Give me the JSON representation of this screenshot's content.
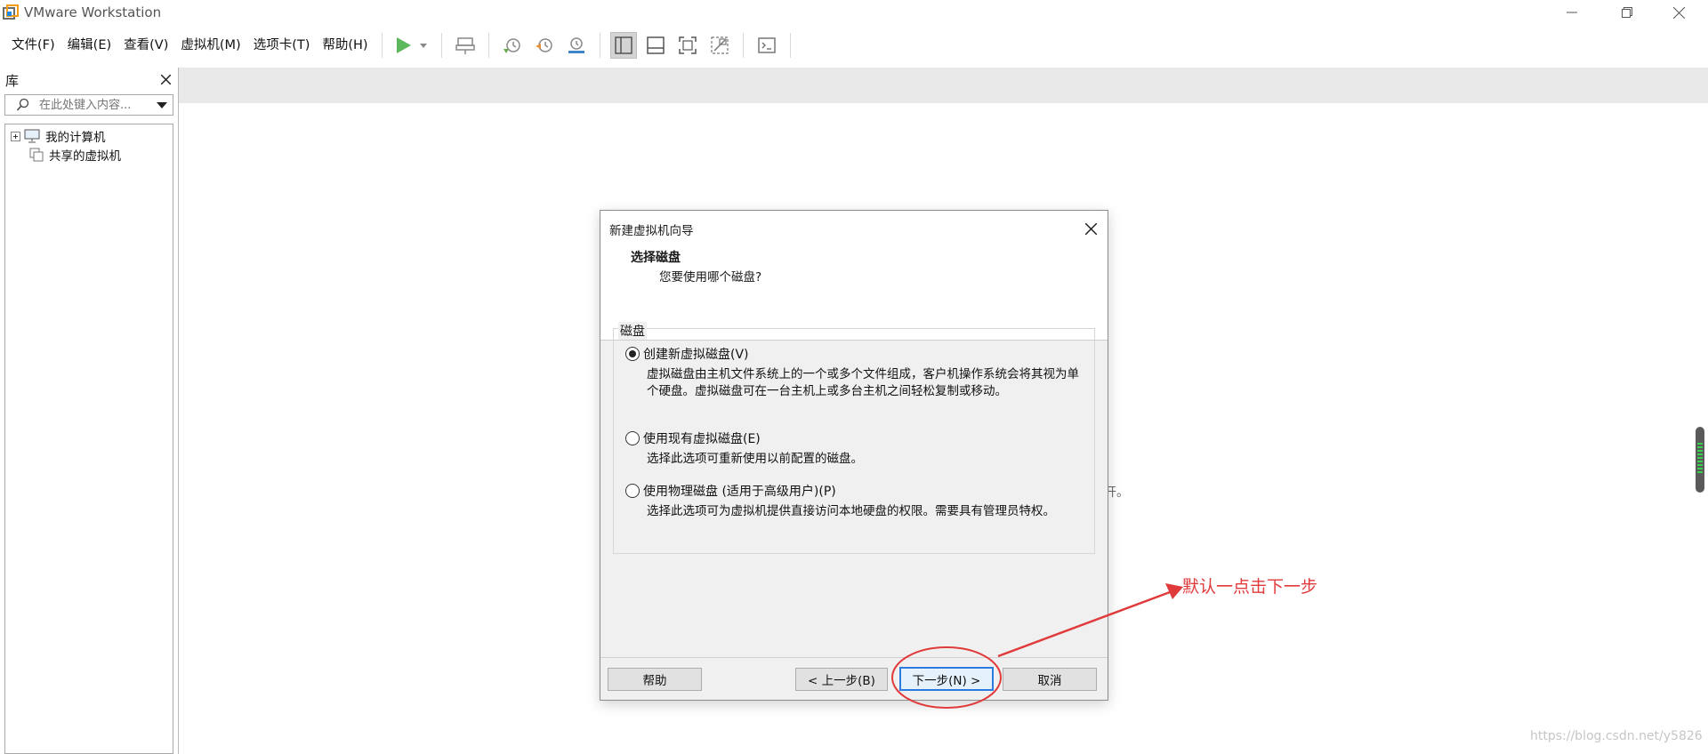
{
  "window": {
    "title": "VMware Workstation"
  },
  "menu": {
    "items": [
      {
        "label": "文件(F)"
      },
      {
        "label": "编辑(E)"
      },
      {
        "label": "查看(V)"
      },
      {
        "label": "虚拟机(M)"
      },
      {
        "label": "选项卡(T)"
      },
      {
        "label": "帮助(H)"
      }
    ]
  },
  "library": {
    "title": "库",
    "search_placeholder": "在此处键入内容...",
    "tree": [
      {
        "label": "我的计算机"
      },
      {
        "label": "共享的虚拟机"
      }
    ]
  },
  "main": {
    "background_text_fragment": "开。",
    "watermark": "https://blog.csdn.net/y5826"
  },
  "dialog": {
    "title": "新建虚拟机向导",
    "heading": "选择磁盘",
    "subheading": "您要使用哪个磁盘?",
    "group_label": "磁盘",
    "options": [
      {
        "label": "创建新虚拟磁盘(V)",
        "checked": true,
        "description": "虚拟磁盘由主机文件系统上的一个或多个文件组成，客户机操作系统会将其视为单个硬盘。虚拟磁盘可在一台主机上或多台主机之间轻松复制或移动。"
      },
      {
        "label": "使用现有虚拟磁盘(E)",
        "checked": false,
        "description": "选择此选项可重新使用以前配置的磁盘。"
      },
      {
        "label": "使用物理磁盘 (适用于高级用户)(P)",
        "checked": false,
        "description": "选择此选项可为虚拟机提供直接访问本地硬盘的权限。需要具有管理员特权。"
      }
    ],
    "buttons": {
      "help": "帮助",
      "back": "< 上一步(B)",
      "next": "下一步(N) >",
      "cancel": "取消"
    }
  },
  "annotation": {
    "text": "默认一点击下一步",
    "color": "#e03a3a"
  }
}
